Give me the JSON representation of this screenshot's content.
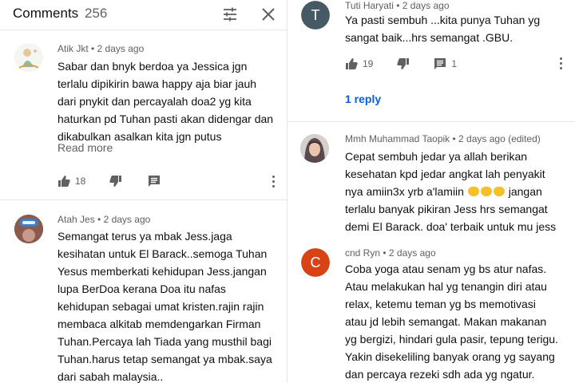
{
  "header": {
    "title": "Comments",
    "count": "256"
  },
  "left": {
    "c1": {
      "author": "Atik Jkt",
      "age": "2 days ago",
      "text": "Sabar dan bnyk berdoa ya Jessica jgn\nterlalu dipikirin bawa happy aja biar jauh\ndari pnykit dan percayalah doa2 yg kita\nhaturkan pd Tuhan pasti akan didengar dan\ndikabulkan asalkan kita jgn putus",
      "read_more": "Read more",
      "likes": "18"
    },
    "c2": {
      "author": "Atah Jes",
      "age": "2 days ago",
      "text": "Semangat terus ya mbak Jess.jaga\nkesihatan  untuk El Barack..semoga Tuhan\nYesus memberkati kehidupan Jess.jangan\nlupa BerDoa kerana Doa itu nafas\nkehidupan sebagai umat kristen.rajin rajin\nmembaca alkitab memdengarkan Firman\nTuhan.Percaya lah Tiada yang musthil bagi\nTuhan.harus tetap semangat ya mbak.saya\ndari sabah malaysia.."
    }
  },
  "right": {
    "c1": {
      "avatar_letter": "T",
      "avatar_color": "#455a64",
      "author": "Tuti Haryati",
      "age": "2 days ago",
      "text": "Ya pasti sembuh ...kita punya Tuhan yg\nsangat baik...hrs semangat .GBU.",
      "likes": "19",
      "replies": "1",
      "reply_link": "1 reply"
    },
    "c2": {
      "author": "Mmh Muhammad Taopik",
      "age": "2 days ago (edited)",
      "line1": "Cepat sembuh jedar ya allah berikan",
      "line2": "kesehatan kpd jedar angkat lah penyakit",
      "line3_start": "nya amiin3x yrb a'lamiin",
      "line3_end": "jangan",
      "line4": "terlalu banyak pikiran Jess hrs semangat",
      "line5": "demi El Barack. doa' terbaik untuk mu jess"
    },
    "c3": {
      "avatar_letter": "C",
      "avatar_color": "#d84315",
      "author": "cnd Ryn",
      "age": "2 days ago",
      "text": "Coba yoga atau senam yg bs atur nafas.\nAtau melakukan hal yg tenangin diri atau\nrelax, ketemu teman yg bs memotivasi\natau jd lebih semangat. Makan makanan\nyg bergizi, hindari gula pasir, tepung terigu.\nYakin disekeliling banyak orang yg sayang\ndan percaya rezeki sdh ada yg ngatur."
    }
  },
  "colors": {
    "accent_link": "#065fd4",
    "meta_text": "#606060",
    "divider": "#e5e5e5"
  },
  "icons": [
    "tune-icon",
    "close-icon",
    "thumb-up-icon",
    "thumb-down-icon",
    "reply-icon",
    "more-vert-icon"
  ]
}
